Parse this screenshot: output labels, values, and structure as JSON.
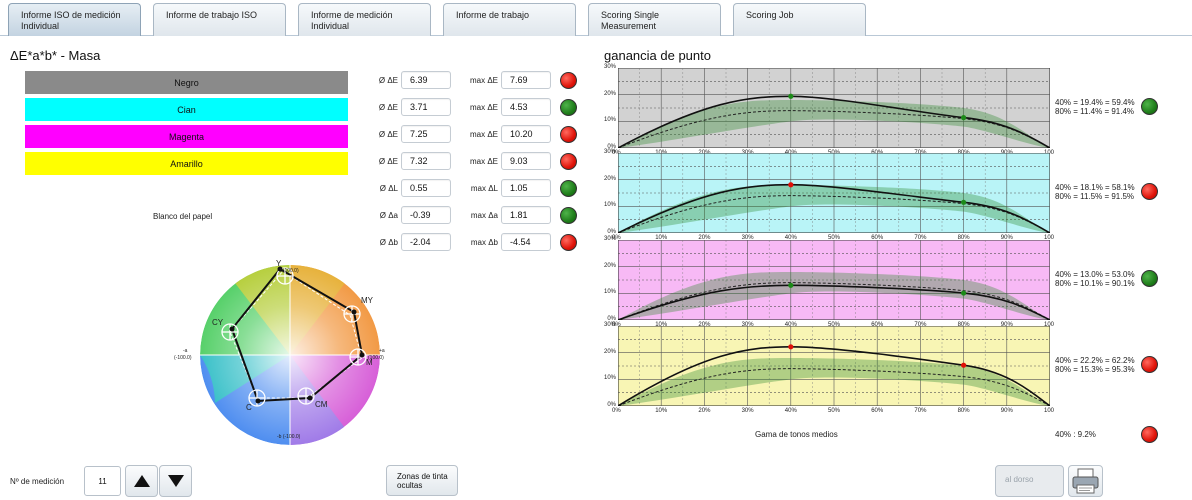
{
  "tabs": [
    {
      "line1": "Informe ISO de medición",
      "line2": "Individual",
      "active": true
    },
    {
      "line1": "Informe de trabajo ISO",
      "line2": "",
      "active": false
    },
    {
      "line1": "Informe de medición",
      "line2": "Individual",
      "active": false
    },
    {
      "line1": "Informe de trabajo",
      "line2": "",
      "active": false
    },
    {
      "line1": "Scoring Single",
      "line2": "Measurement",
      "active": false
    },
    {
      "line1": "Scoring Job",
      "line2": "",
      "active": false
    }
  ],
  "left_title": "ΔE*a*b* - Masa",
  "swatches": [
    {
      "label": "Negro",
      "color": "#8a8a8a"
    },
    {
      "label": "Cian",
      "color": "#00ffff"
    },
    {
      "label": "Magenta",
      "color": "#ff00ff"
    },
    {
      "label": "Amarillo",
      "color": "#ffff00"
    }
  ],
  "paper_label": "Blanco del papel",
  "metrics": [
    {
      "label": "Ø ΔE",
      "value": "6.39",
      "max_label": "max ΔE",
      "max_value": "7.69",
      "status": "red"
    },
    {
      "label": "Ø ΔE",
      "value": "3.71",
      "max_label": "max ΔE",
      "max_value": "4.53",
      "status": "green"
    },
    {
      "label": "Ø ΔE",
      "value": "7.25",
      "max_label": "max ΔE",
      "max_value": "10.20",
      "status": "red"
    },
    {
      "label": "Ø ΔE",
      "value": "7.32",
      "max_label": "max ΔE",
      "max_value": "9.03",
      "status": "red"
    },
    {
      "label": "Ø ΔL",
      "value": "0.55",
      "max_label": "max ΔL",
      "max_value": "1.05",
      "status": "green"
    },
    {
      "label": "Ø Δa",
      "value": "-0.39",
      "max_label": "max Δa",
      "max_value": "1.81",
      "status": "green"
    },
    {
      "label": "Ø Δb",
      "value": "-2.04",
      "max_label": "max Δb",
      "max_value": "-4.54",
      "status": "red"
    }
  ],
  "color_wheel": {
    "axis_top": "b(100.0)",
    "axis_bottom": "-b (-100.0)",
    "axis_left_top": "-a",
    "axis_left_bottom": "(-100.0)",
    "axis_right_top": "+a",
    "axis_right_bottom": "(100.0)",
    "points": [
      "Y",
      "MY",
      "M",
      "CM",
      "C",
      "CY"
    ]
  },
  "right_title": "ganancia de punto",
  "x_ticks": [
    "0%",
    "10%",
    "20%",
    "30%",
    "40%",
    "50%",
    "60%",
    "70%",
    "80%",
    "90%",
    "100"
  ],
  "y_ticks": [
    "0%",
    "10%",
    "20%",
    "30%"
  ],
  "chart_data": [
    {
      "type": "line",
      "name": "Negro",
      "bg": "#d2d2d2",
      "x": [
        0,
        40,
        80,
        100
      ],
      "measured": [
        0,
        19.4,
        11.4,
        0
      ],
      "reference": [
        0,
        14.0,
        11.0,
        0
      ],
      "text40": "40% = 19.4% = 59.4%",
      "text80": "80% = 11.4% = 91.4%",
      "status": "green",
      "p40": "green",
      "p80": "green"
    },
    {
      "type": "line",
      "name": "Cian",
      "bg": "#b9f4f7",
      "x": [
        0,
        40,
        80,
        100
      ],
      "measured": [
        0,
        18.1,
        11.5,
        0
      ],
      "reference": [
        0,
        14.0,
        11.0,
        0
      ],
      "text40": "40% = 18.1% = 58.1%",
      "text80": "80% = 11.5% = 91.5%",
      "status": "red",
      "p40": "red",
      "p80": "green"
    },
    {
      "type": "line",
      "name": "Magenta",
      "bg": "#f7b9f5",
      "x": [
        0,
        40,
        80,
        100
      ],
      "measured": [
        0,
        13.0,
        10.1,
        0
      ],
      "reference": [
        0,
        14.0,
        11.0,
        0
      ],
      "text40": "40% = 13.0% = 53.0%",
      "text80": "80% = 10.1% = 90.1%",
      "status": "green",
      "p40": "green",
      "p80": "green"
    },
    {
      "type": "line",
      "name": "Amarillo",
      "bg": "#f8f5b4",
      "x": [
        0,
        40,
        80,
        100
      ],
      "measured": [
        0,
        22.2,
        15.3,
        0
      ],
      "reference": [
        0,
        14.0,
        11.0,
        0
      ],
      "text40": "40% = 22.2% = 62.2%",
      "text80": "80% = 15.3% = 95.3%",
      "status": "red",
      "p40": "red",
      "p80": "red"
    }
  ],
  "midtone_label": "Gama de tonos medios",
  "midtone_value": "40% : 9.2%",
  "midtone_status": "red",
  "bottom": {
    "measure_label": "Nº de medición",
    "measure_value": "11",
    "hidden_zones": "Zonas de tinta ocultas",
    "back_label": "al dorso"
  }
}
